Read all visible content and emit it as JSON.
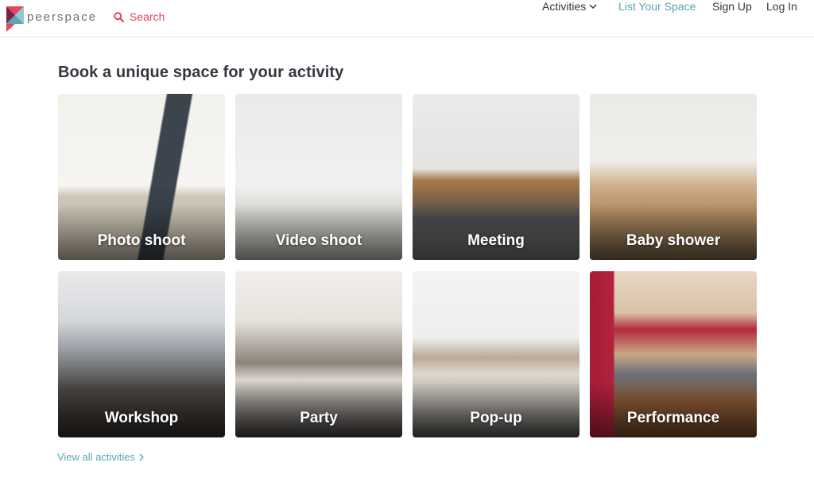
{
  "header": {
    "brand": "peerspace",
    "search_label": "Search",
    "nav": {
      "activities": "Activities",
      "list_your_space": "List Your Space",
      "sign_up": "Sign Up",
      "log_in": "Log In"
    }
  },
  "colors": {
    "brand_red": "#e2475b",
    "accent_teal": "#5aa5b2",
    "text_dark": "#333740"
  },
  "main": {
    "heading": "Book a unique space for your activity",
    "activities": [
      {
        "label": "Photo shoot"
      },
      {
        "label": "Video shoot"
      },
      {
        "label": "Meeting"
      },
      {
        "label": "Baby shower"
      },
      {
        "label": "Workshop"
      },
      {
        "label": "Party"
      },
      {
        "label": "Pop-up"
      },
      {
        "label": "Performance"
      }
    ],
    "view_all": "View all activities"
  }
}
